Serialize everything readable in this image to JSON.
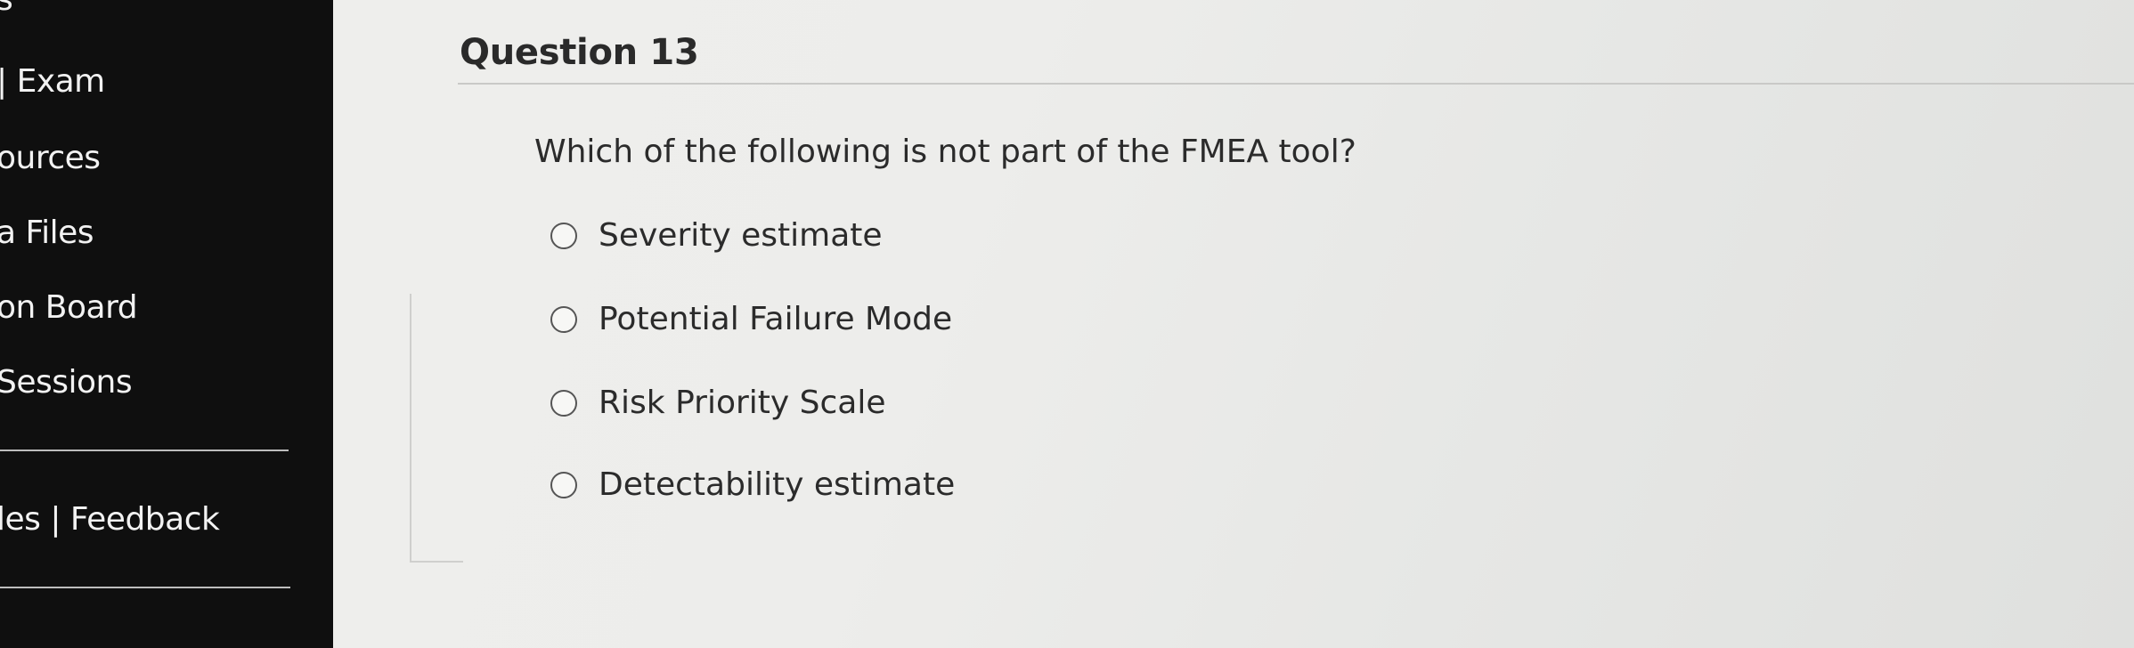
{
  "sidebar": {
    "items": [
      {
        "label": "s"
      },
      {
        "label": "| Exam"
      },
      {
        "label": "ources"
      },
      {
        "label": "a Files"
      },
      {
        "label": "on Board"
      },
      {
        "label": "Sessions"
      },
      {
        "label": "les | Feedback"
      }
    ]
  },
  "question": {
    "title": "Question 13",
    "prompt": "Which of the following is not part of the FMEA tool?",
    "options": [
      {
        "label": "Severity estimate",
        "selected": false
      },
      {
        "label": "Potential Failure Mode",
        "selected": false
      },
      {
        "label": "Risk Priority Scale",
        "selected": false
      },
      {
        "label": "Detectability estimate",
        "selected": false
      }
    ]
  },
  "colors": {
    "sidebar_background": "#0f0f0f",
    "content_background": "#eeeeec",
    "text": "#2b2b2b"
  }
}
